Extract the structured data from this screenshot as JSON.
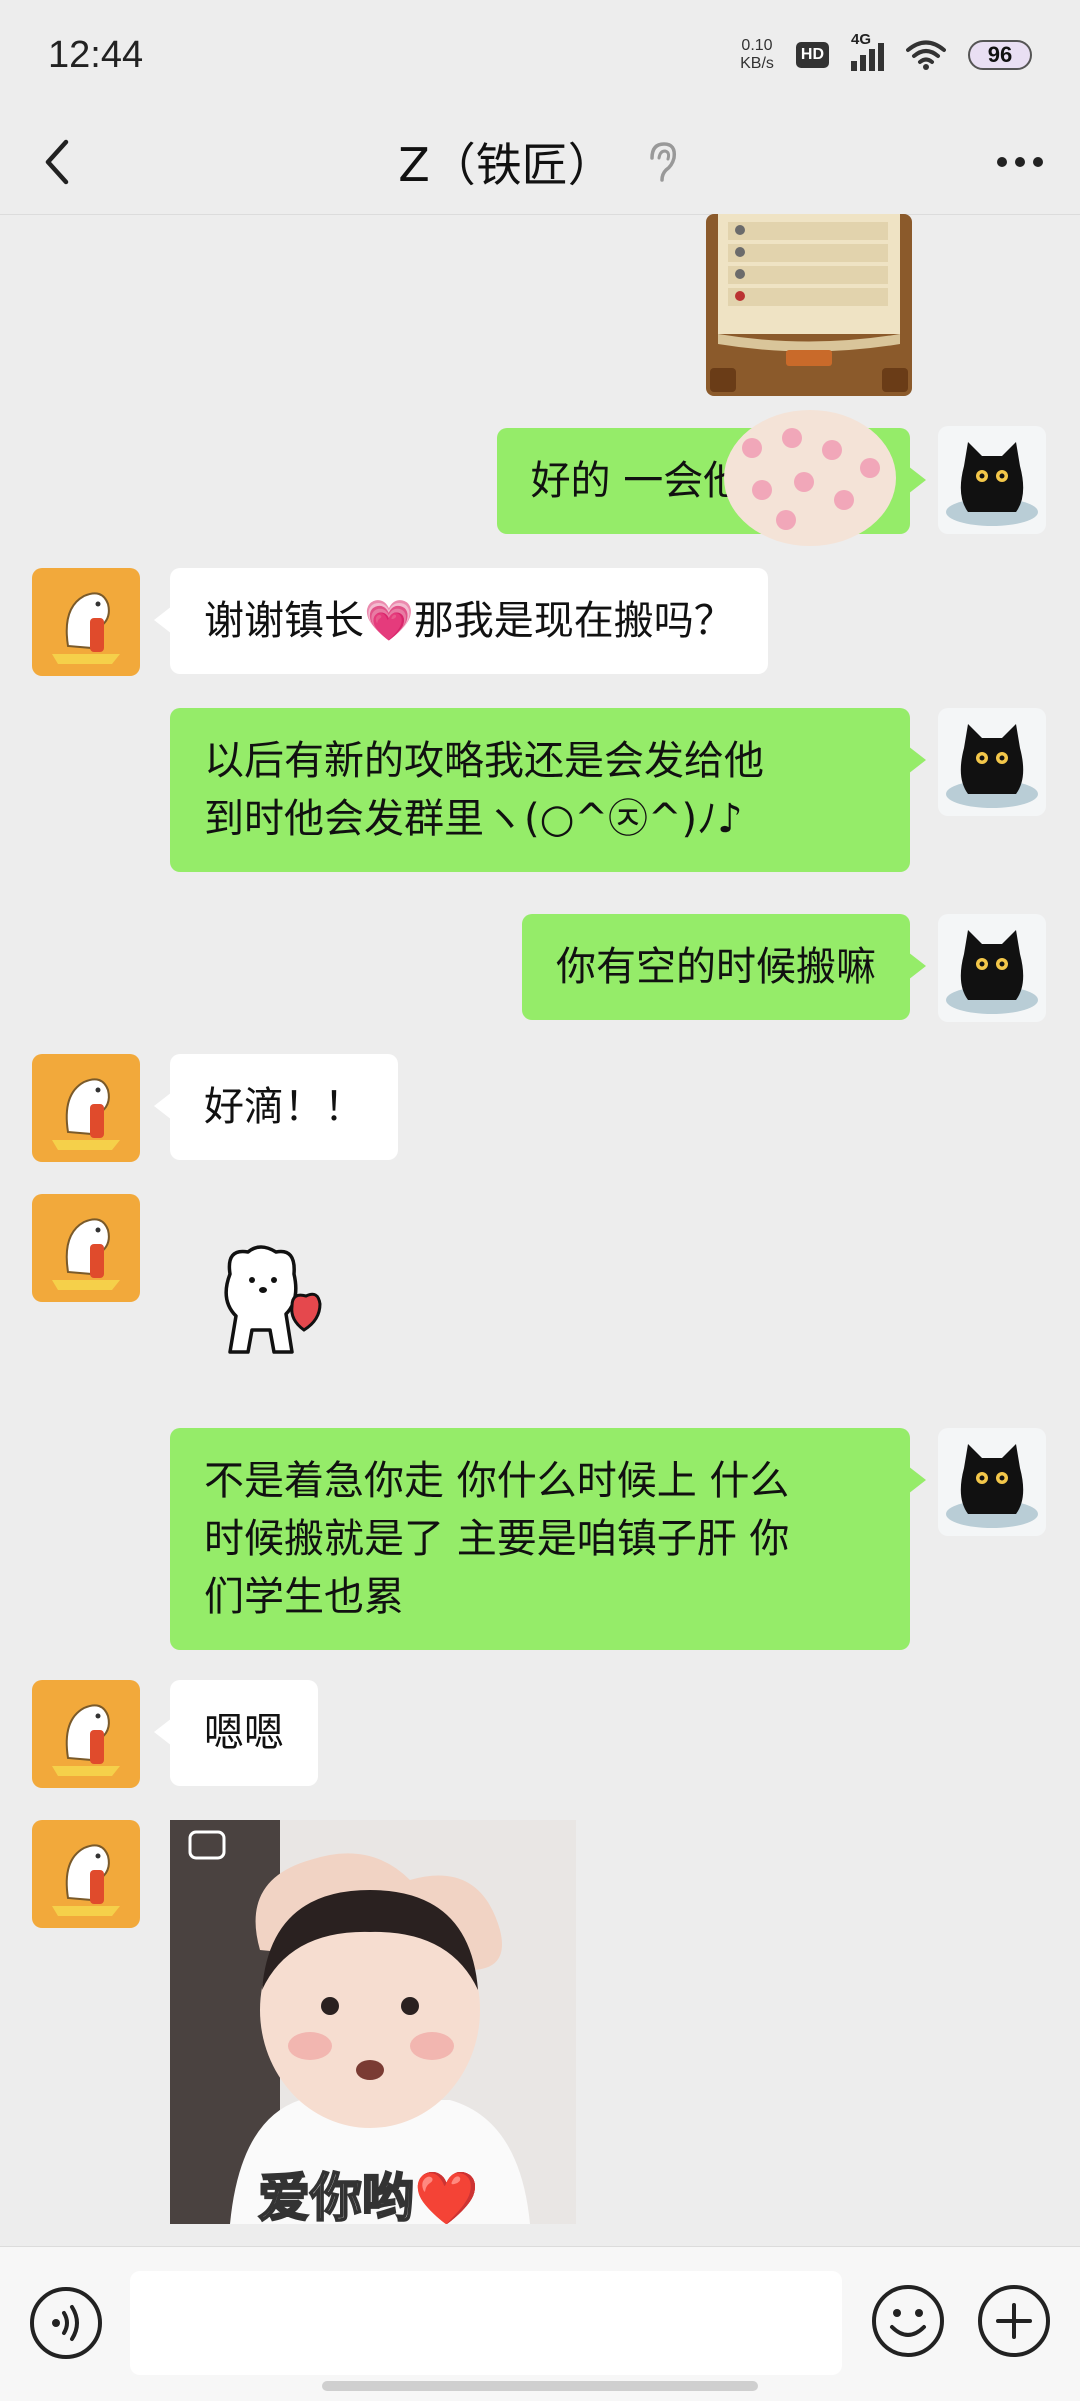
{
  "status_bar": {
    "time": "12:44",
    "net_speed_value": "0.10",
    "net_speed_unit": "KB/s",
    "hd_label": "HD",
    "network_label": "4G",
    "battery": "96"
  },
  "header": {
    "title": "Z（铁匠）"
  },
  "messages": [
    {
      "side": "right",
      "type": "text",
      "text": "好的 一会他加你 吖"
    },
    {
      "side": "left",
      "type": "text",
      "text": "谢谢镇长💗那我是现在搬吗？"
    },
    {
      "side": "right",
      "type": "text",
      "text": "以后有新的攻略我还是会发给他\n到时他会发群里ヽ(○^㉨^)ﾉ♪"
    },
    {
      "side": "right",
      "type": "text",
      "text": "你有空的时候搬嘛"
    },
    {
      "side": "left",
      "type": "text",
      "text": "好滴！！"
    },
    {
      "side": "left",
      "type": "sticker",
      "icon": "dog-heart-sticker"
    },
    {
      "side": "right",
      "type": "text",
      "text": "不是着急你走 你什么时候上 什么\n时候搬就是了 主要是咱镇子肝 你\n们学生也累"
    },
    {
      "side": "left",
      "type": "text",
      "text": "嗯嗯"
    },
    {
      "side": "left",
      "type": "image",
      "caption": "爱你哟❤️"
    }
  ],
  "input": {
    "placeholder": ""
  },
  "colors": {
    "background": "#ededed",
    "bubble_self": "#95ec69",
    "bubble_other": "#ffffff",
    "left_avatar_bg": "#f2a93b"
  }
}
